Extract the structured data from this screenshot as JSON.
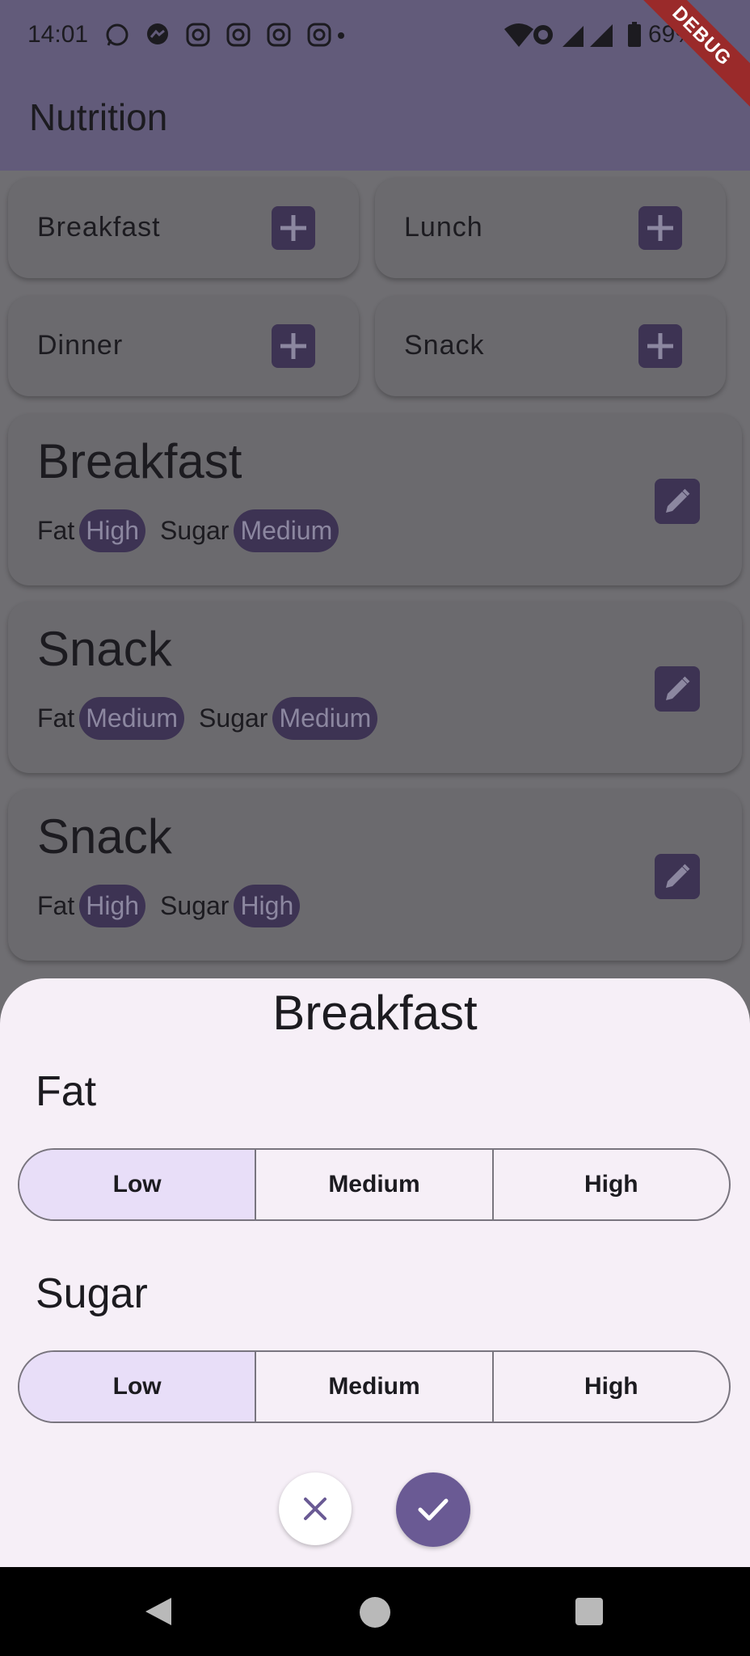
{
  "status_bar": {
    "time": "14:01",
    "notification_icons": [
      "whatsapp-icon",
      "messenger-icon",
      "instagram-icon",
      "instagram-icon",
      "instagram-icon",
      "instagram-icon"
    ],
    "battery": "69%"
  },
  "debug_banner": "DEBUG",
  "app_bar": {
    "title": "Nutrition"
  },
  "add_buttons": [
    {
      "label": "Breakfast"
    },
    {
      "label": "Lunch"
    },
    {
      "label": "Dinner"
    },
    {
      "label": "Snack"
    }
  ],
  "meals": [
    {
      "name": "Breakfast",
      "fat_label": "Fat",
      "fat": "High",
      "sugar_label": "Sugar",
      "sugar": "Medium"
    },
    {
      "name": "Snack",
      "fat_label": "Fat",
      "fat": "Medium",
      "sugar_label": "Sugar",
      "sugar": "Medium"
    },
    {
      "name": "Snack",
      "fat_label": "Fat",
      "fat": "High",
      "sugar_label": "Sugar",
      "sugar": "High"
    }
  ],
  "sheet": {
    "title": "Breakfast",
    "fat": {
      "label": "Fat",
      "options": [
        "Low",
        "Medium",
        "High"
      ],
      "selected": "Low"
    },
    "sugar": {
      "label": "Sugar",
      "options": [
        "Low",
        "Medium",
        "High"
      ],
      "selected": "Low"
    }
  },
  "colors": {
    "accent": "#6a5a94",
    "selected_segment": "#e8def8",
    "sheet_bg": "#f6eff7",
    "pill_bg": "#3d3353",
    "debug_red": "#9a2a2a"
  }
}
